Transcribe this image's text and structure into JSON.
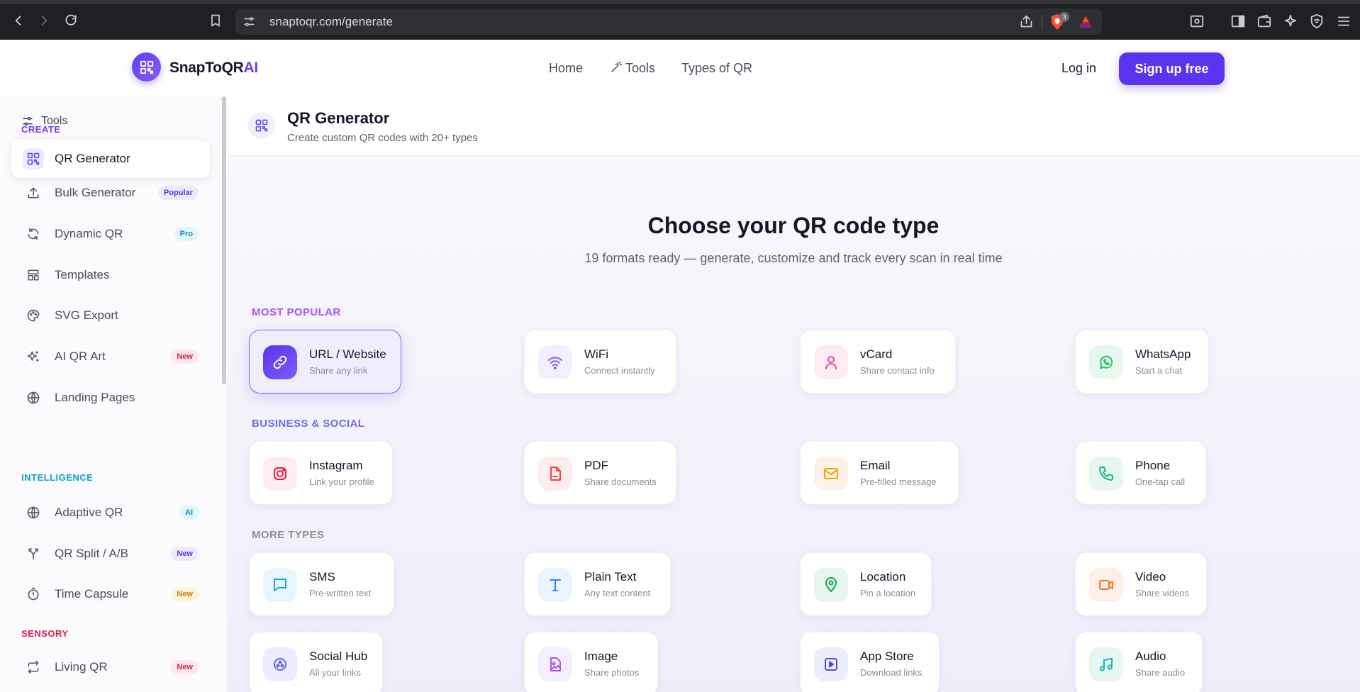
{
  "browser": {
    "url": "snaptoqr.com/generate",
    "shield_count": "3"
  },
  "brand": {
    "name": "SnapToQR",
    "suffix": "AI",
    "accent": "#5b34f0"
  },
  "topnav": {
    "home": "Home",
    "tools": "Tools",
    "types": "Types of QR",
    "login": "Log in",
    "signup": "Sign up free"
  },
  "sidebar": {
    "tools_label": "Tools",
    "sections": {
      "create": "CREATE",
      "intelligence": "INTELLIGENCE",
      "sensory": "SENSORY"
    },
    "items": [
      {
        "label": "QR Generator",
        "tag": "",
        "icon": "qr-icon"
      },
      {
        "label": "Bulk Generator",
        "tag": "Popular",
        "icon": "upload-icon"
      },
      {
        "label": "Dynamic QR",
        "tag": "Pro",
        "icon": "refresh-icon"
      },
      {
        "label": "Templates",
        "tag": "",
        "icon": "layout-icon"
      },
      {
        "label": "SVG Export",
        "tag": "",
        "icon": "palette-icon"
      },
      {
        "label": "AI QR Art",
        "tag": "New",
        "icon": "sparkle-icon"
      },
      {
        "label": "Landing Pages",
        "tag": "",
        "icon": "globe-icon"
      },
      {
        "label": "Adaptive QR",
        "tag": "AI",
        "icon": "globe-icon"
      },
      {
        "label": "QR Split / A/B",
        "tag": "New",
        "icon": "split-icon"
      },
      {
        "label": "Time Capsule",
        "tag": "New",
        "icon": "timer-icon"
      },
      {
        "label": "Living QR",
        "tag": "New",
        "icon": "repeat-icon"
      }
    ]
  },
  "page": {
    "title": "QR Generator",
    "subtitle": "Create custom QR codes with 20+ types",
    "hero_title": "Choose your QR code type",
    "hero_subtitle": "19 formats ready — generate, customize and track every scan in real time"
  },
  "groups": {
    "popular": "MOST POPULAR",
    "business": "BUSINESS & SOCIAL",
    "more": "MORE TYPES"
  },
  "cards": [
    {
      "title": "URL / Website",
      "subtitle": "Share any link",
      "icon": "link-icon"
    },
    {
      "title": "WiFi",
      "subtitle": "Connect instantly",
      "icon": "wifi-icon"
    },
    {
      "title": "vCard",
      "subtitle": "Share contact info",
      "icon": "user-icon"
    },
    {
      "title": "WhatsApp",
      "subtitle": "Start a chat",
      "icon": "whatsapp-icon"
    },
    {
      "title": "Instagram",
      "subtitle": "Link your profile",
      "icon": "instagram-icon"
    },
    {
      "title": "PDF",
      "subtitle": "Share documents",
      "icon": "pdf-icon"
    },
    {
      "title": "Email",
      "subtitle": "Pre-filled message",
      "icon": "mail-icon"
    },
    {
      "title": "Phone",
      "subtitle": "One-tap call",
      "icon": "phone-icon"
    },
    {
      "title": "SMS",
      "subtitle": "Pre-written text",
      "icon": "message-icon"
    },
    {
      "title": "Plain Text",
      "subtitle": "Any text content",
      "icon": "text-icon"
    },
    {
      "title": "Location",
      "subtitle": "Pin a location",
      "icon": "pin-icon"
    },
    {
      "title": "Video",
      "subtitle": "Share videos",
      "icon": "video-icon"
    },
    {
      "title": "Social Hub",
      "subtitle": "All your links",
      "icon": "hub-icon"
    },
    {
      "title": "Image",
      "subtitle": "Share photos",
      "icon": "image-icon"
    },
    {
      "title": "App Store",
      "subtitle": "Download links",
      "icon": "play-icon"
    },
    {
      "title": "Audio",
      "subtitle": "Share audio",
      "icon": "music-icon"
    }
  ]
}
